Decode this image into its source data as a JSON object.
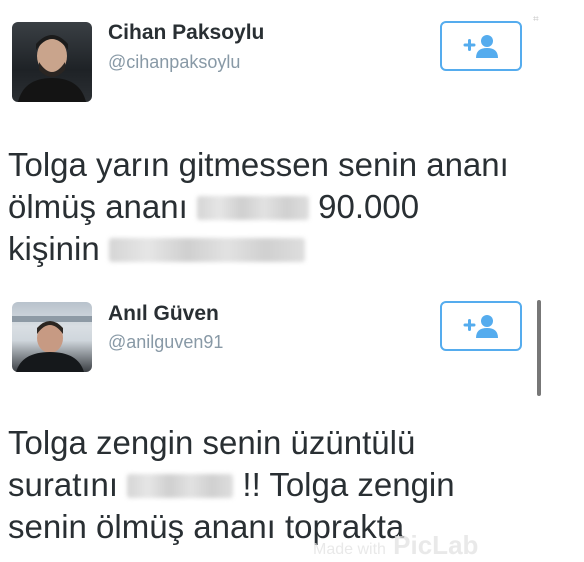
{
  "tweets": [
    {
      "display_name": "Cihan Paksoylu",
      "handle": "@cihanpaksoylu",
      "avatar_icon": "user-photo-avatar",
      "follow_icon": "add-user-icon",
      "text": {
        "line1": "Tolga yarın gitmessen senin ananı",
        "line2_start": "ölmüş ananı",
        "line2_end": "90.000",
        "line3_start": "kişinin"
      }
    },
    {
      "display_name": "Anıl Güven",
      "handle": "@anilguven91",
      "avatar_icon": "user-photo-avatar",
      "follow_icon": "add-user-icon",
      "text": {
        "line1": "Tolga zengin senin üzüntülü",
        "line2_start": "suratını",
        "line2_end": "!! Tolga zengin",
        "line3": "senin ölmüş ananı toprakta"
      }
    }
  ],
  "watermark": {
    "prefix": "Made with",
    "brand": "PicLab"
  },
  "colors": {
    "accent": "#55acee",
    "text": "#292f33",
    "muted": "#8899a6"
  }
}
